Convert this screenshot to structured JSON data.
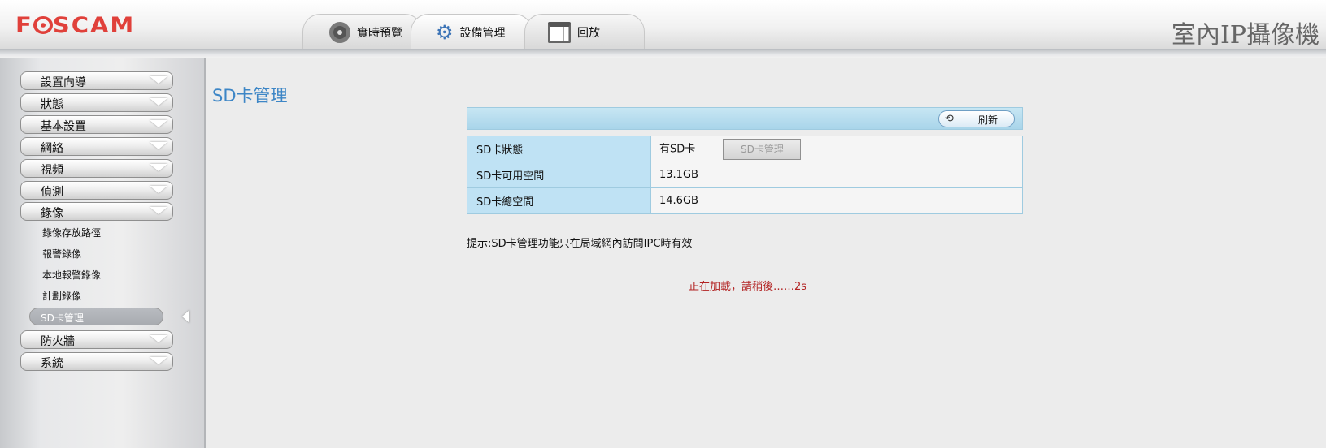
{
  "header": {
    "logo": "FOSCAM",
    "product_title": "室內IP攝像機",
    "tabs": [
      {
        "label": "實時預覽",
        "icon": "webcam-icon"
      },
      {
        "label": "設備管理",
        "icon": "gear-icon"
      },
      {
        "label": "回放",
        "icon": "calendar-icon"
      }
    ]
  },
  "sidebar": {
    "menu": [
      {
        "label": "設置向導"
      },
      {
        "label": "狀態"
      },
      {
        "label": "基本設置"
      },
      {
        "label": "網絡"
      },
      {
        "label": "視頻"
      },
      {
        "label": "偵測"
      },
      {
        "label": "錄像"
      }
    ],
    "submenu": [
      {
        "label": "錄像存放路徑"
      },
      {
        "label": "報警錄像"
      },
      {
        "label": "本地報警錄像"
      },
      {
        "label": "計劃錄像"
      }
    ],
    "selected_submenu": "SD卡管理",
    "menu_after": [
      {
        "label": "防火牆"
      },
      {
        "label": "系統"
      }
    ]
  },
  "main": {
    "section_title": "SD卡管理",
    "refresh_label": "刷新",
    "rows": [
      {
        "key": "SD卡狀態",
        "value": "有SD卡"
      },
      {
        "key": "SD卡可用空間",
        "value": "13.1GB"
      },
      {
        "key": "SD卡總空間",
        "value": "14.6GB"
      }
    ],
    "sd_manage_button": "SD卡管理",
    "hint": "提示:SD卡管理功能只在局域網內訪問IPC時有效",
    "loading": "正在加載，請稍後……2s"
  },
  "colors": {
    "logo_red": "#e0403a",
    "title_blue": "#3d86c6",
    "loading_red": "#b22222",
    "table_key_bg": "#bfe2f4"
  }
}
